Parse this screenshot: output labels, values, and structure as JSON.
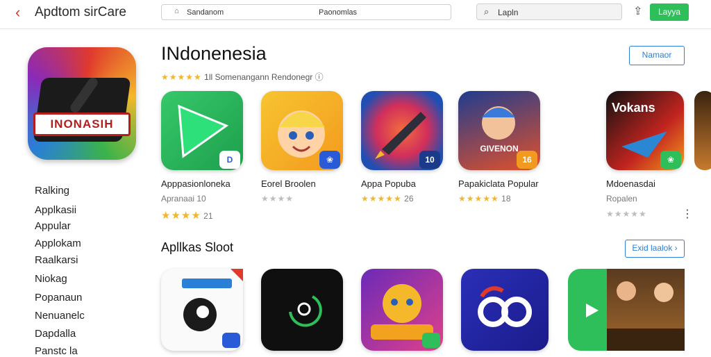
{
  "topbar": {
    "back_icon": "chevron-left-icon",
    "app_title": "Apdtom sirCare",
    "url_left": "Sandanom",
    "url_right": "Paonomlas",
    "search_text": "Lapln",
    "action_button": "Layya"
  },
  "hero": {
    "label": "INONASIH"
  },
  "main": {
    "heading": "INdonenesia",
    "subtitle_rating": "★★★★★",
    "subtitle_text": "1ll Somenangann  Rendonegr",
    "namaor_button": "Namaor"
  },
  "sidebar": {
    "items": [
      "Ralking",
      "Applkasii",
      "Appular",
      "Applokam",
      "Raalkarsi",
      "Niokag",
      "Popanaun",
      "Nenuanelc",
      "Dapdalla",
      "Panstc la"
    ]
  },
  "apps_row1": [
    {
      "name": "Apppasionloneka",
      "meta": "Apranaai 10",
      "rating_stars": "★★★★",
      "rating_count": "21",
      "badge": "D",
      "badge_color": "#2a5bd7"
    },
    {
      "name": "Eorel Broolen",
      "meta": "",
      "rating_stars": "★★★★",
      "rating_count": "",
      "badge": "❀",
      "badge_color": "#2a5bd7"
    },
    {
      "name": "Appa Popuba",
      "meta": "",
      "rating_stars": "★★★★★",
      "rating_count": "26",
      "badge": "10",
      "badge_color": "#1b3a8a"
    },
    {
      "name": "Papakiclata Popular",
      "meta": "",
      "rating_stars": "★★★★★",
      "rating_count": "18",
      "badge": "16",
      "badge_color": "#f29a1f"
    },
    {
      "name": "Mdoenasdai",
      "meta": "Ropalen",
      "rating_stars": "★★★★★",
      "rating_count": "",
      "badge": "❀",
      "badge_color": "#2fbf5a"
    }
  ],
  "section2": {
    "title": "Apllkas Sloot",
    "button": "Exid laalok ›"
  },
  "tile_labels": {
    "fifth": "Vokans",
    "fourth": "GIVENON"
  }
}
